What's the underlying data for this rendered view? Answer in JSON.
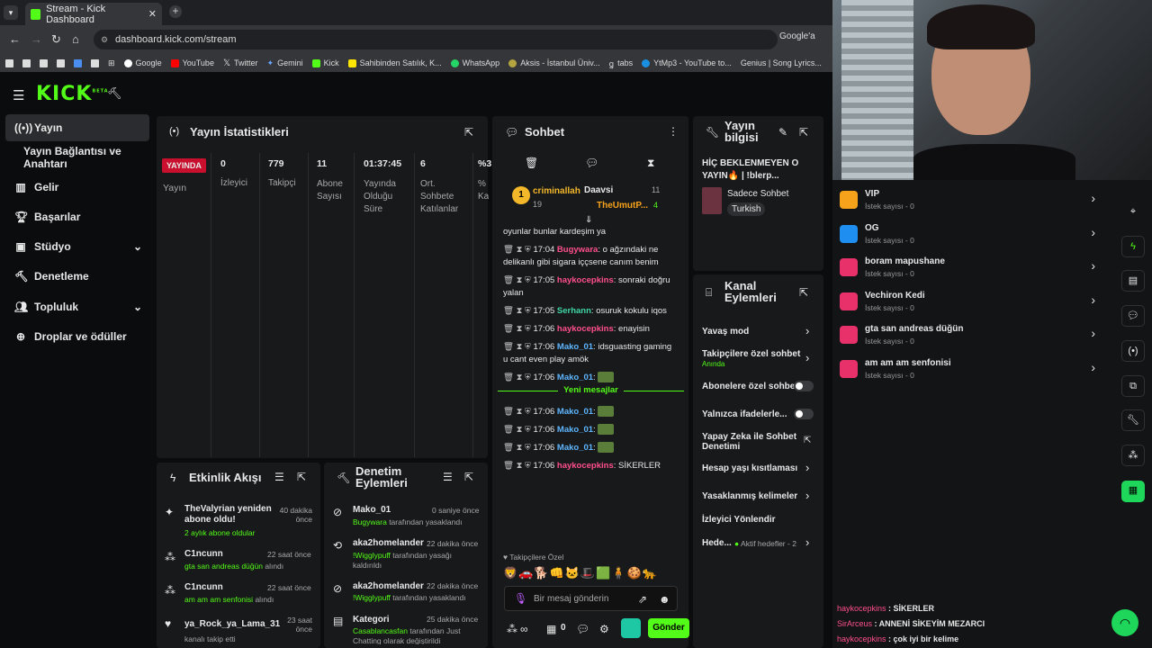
{
  "browser": {
    "tab_title": "Stream - Kick Dashboard",
    "url": "dashboard.kick.com/stream",
    "google_btn": "Google'a",
    "bookmarks": [
      "Google",
      "YouTube",
      "Twitter",
      "Gemini",
      "Kick",
      "Sahibinden Satılık, K...",
      "WhatsApp",
      "Aksis - İstanbul Üniv...",
      "tabs",
      "YtMp3 - YouTube to...",
      "Genius | Song Lyrics..."
    ]
  },
  "nav": {
    "logo": "KICK",
    "beta": "BETA",
    "items": [
      "Yayın",
      "Yayın Bağlantısı ve Anahtarı",
      "Gelir",
      "Başarılar",
      "Stüdyo",
      "Denetleme",
      "Topluluk",
      "Droplar ve ödüller"
    ]
  },
  "stats": {
    "title": "Yayın İstatistikleri",
    "badge": "YAYINDA",
    "status": "Yayın",
    "cols": [
      {
        "v": "0",
        "l": "İzleyici"
      },
      {
        "v": "779",
        "l": "Takipçi"
      },
      {
        "v": "11",
        "l": "Abone Sayısı"
      },
      {
        "v": "01:37:45",
        "l": "Yayında Olduğu Süre"
      },
      {
        "v": "6",
        "l": "Ort. Sohbete Katılanlar"
      },
      {
        "v": "%3",
        "l": "% Ka"
      }
    ]
  },
  "activity": {
    "title": "Etkinlik Akışı",
    "items": [
      {
        "name": "TheValyrian yeniden abone oldu!",
        "sub": "2 aylık abone oldular",
        "time": "40 dakika önce"
      },
      {
        "name": "C1ncunn",
        "sub": "gta san andreas düğün",
        "sub2": "alındı",
        "time": "22 saat önce"
      },
      {
        "name": "C1ncunn",
        "sub": "am am am senfonisi",
        "sub2": "alındı",
        "time": "22 saat önce"
      },
      {
        "name": "ya_Rock_ya_Lama_31",
        "sub": "kanalı takip etti",
        "time": "23 saat önce"
      }
    ]
  },
  "moderation": {
    "title": "Denetim Eylemleri",
    "items": [
      {
        "name": "Mako_01",
        "by": "Bugywara",
        "txt": "tarafından yasaklandı",
        "time": "0 saniye önce"
      },
      {
        "name": "aka2homelander",
        "by": "!Wigglypuff",
        "txt": "tarafından yasağı kaldırıldı",
        "time": "22 dakika önce"
      },
      {
        "name": "aka2homelander",
        "by": "!Wigglypuff",
        "txt": "tarafından yasaklandı",
        "time": "22 dakika önce"
      },
      {
        "name": "Kategori",
        "by": "Casablancasfan",
        "txt": "tarafından Just Chatting olarak değiştirildi",
        "time": "25 dakika önce"
      }
    ]
  },
  "chat": {
    "title": "Sohbet",
    "top": [
      {
        "rank": "1",
        "name": "criminallah",
        "count": "19"
      },
      {
        "name": "Daavsi",
        "count": "11"
      },
      {
        "name": "TheUmutP...",
        "count": "4"
      }
    ],
    "messages": [
      {
        "time": "",
        "user": "",
        "text": "oyunlar bunlar kardeşim ya"
      },
      {
        "time": "17:04",
        "user": "Bugywara",
        "text": "o ağzındaki ne delikanlı gibi sigara iççsene canım benim",
        "color": "#ff4f8b"
      },
      {
        "time": "17:05",
        "user": "haykocepkins",
        "text": "sonraki doğru yalan",
        "color": "#ff4f8b"
      },
      {
        "time": "17:05",
        "user": "Serhann",
        "text": "osuruk kokulu iqos",
        "color": "#3fd6a8"
      },
      {
        "time": "17:06",
        "user": "haykocepkins",
        "text": "enayisin",
        "color": "#ff4f8b"
      },
      {
        "time": "17:06",
        "user": "Mako_01",
        "text": "idsguasting gaming u cant even play amök",
        "color": "#5db6ff"
      },
      {
        "time": "17:06",
        "user": "Mako_01",
        "text": "",
        "color": "#5db6ff"
      }
    ],
    "new_messages": "Yeni mesajlar",
    "messages2": [
      {
        "time": "17:06",
        "user": "Mako_01",
        "text": "",
        "color": "#5db6ff"
      },
      {
        "time": "17:06",
        "user": "Mako_01",
        "text": "",
        "color": "#5db6ff"
      },
      {
        "time": "17:06",
        "user": "Mako_01",
        "text": "",
        "color": "#5db6ff"
      },
      {
        "time": "17:06",
        "user": "haykocepkins",
        "text": "SİKERLER",
        "color": "#ff4f8b"
      }
    ],
    "follower_only": "Takipçilere Özel",
    "placeholder": "Bir mesaj gönderin",
    "send": "Gönder",
    "count": "0"
  },
  "info": {
    "title": "Yayın bilgisi",
    "stream_title": "HİÇ BEKLENMEYEN O YAYIN🔥 | !blerp...",
    "category": "Sadece Sohbet",
    "lang": "Turkish"
  },
  "channel": {
    "title": "Kanal Eylemleri",
    "items": [
      {
        "l": "Yavaş mod"
      },
      {
        "l": "Takipçilere özel sohbet",
        "s": "Anında"
      },
      {
        "l": "Abonelere özel sohbet"
      },
      {
        "l": "Yalnızca ifadelerle..."
      },
      {
        "l": "Yapay Zeka ile Sohbet Denetimi"
      },
      {
        "l": "Hesap yaşı kısıtlaması"
      },
      {
        "l": "Yasaklanmış kelimeler"
      },
      {
        "l": "İzleyici Yönlendir"
      },
      {
        "l": "Hede...",
        "s": "Aktif hedefler - 2"
      }
    ]
  },
  "rewards": [
    {
      "t": "VIP",
      "s": "İstek sayısı - 0",
      "c": "#f7a21b"
    },
    {
      "t": "OG",
      "s": "İstek sayısı - 0",
      "c": "#1f8ef1"
    },
    {
      "t": "boram mapushane",
      "s": "İstek sayısı - 0",
      "c": "#e8306b"
    },
    {
      "t": "Vechiron Kedi",
      "s": "İstek sayısı - 0",
      "c": "#e8306b"
    },
    {
      "t": "gta san andreas düğün",
      "s": "İstek sayısı - 0",
      "c": "#e8306b"
    },
    {
      "t": "am am am senfonisi",
      "s": "İstek sayısı - 0",
      "c": "#e8306b"
    }
  ],
  "overlay_chat": [
    {
      "u": "haykocepkins",
      "t": "SİKERLER",
      "c": "#ff4f8b"
    },
    {
      "u": "SirArceus",
      "t": "ANNENİ SİKEYİM MEZARCI",
      "c": "#ff4f8b"
    },
    {
      "u": "haykocepkins",
      "t": "çok iyi bir kelime",
      "c": "#ff4f8b"
    }
  ]
}
